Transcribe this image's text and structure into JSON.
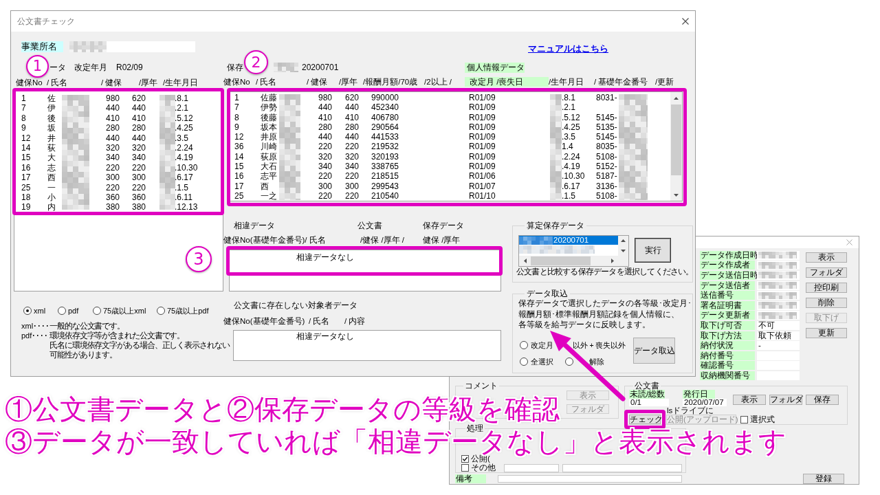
{
  "main_window": {
    "title": "公文書チェック",
    "office_label": "事業所名",
    "manual_link": "マニュアルはこちら",
    "official": {
      "label_end": "ータ",
      "revision_label": "改定年月",
      "revision_value": "R02/09",
      "columns": [
        "健保No",
        "/ 氏名",
        "/ 健保",
        "/厚年",
        "/生年月日"
      ],
      "rows": [
        {
          "no": "1",
          "name": "佐",
          "health": "980",
          "pension": "620",
          "birth": ".8.1"
        },
        {
          "no": "7",
          "name": "伊",
          "health": "440",
          "pension": "440",
          "birth": ".2.1"
        },
        {
          "no": "8",
          "name": "後",
          "health": "410",
          "pension": "410",
          "birth": ".5.12"
        },
        {
          "no": "9",
          "name": "坂",
          "health": "280",
          "pension": "280",
          "birth": ".4.25"
        },
        {
          "no": "12",
          "name": "井",
          "health": "440",
          "pension": "440",
          "birth": ".3.5"
        },
        {
          "no": "14",
          "name": "荻",
          "health": "320",
          "pension": "320",
          "birth": ".2.24"
        },
        {
          "no": "15",
          "name": "大",
          "health": "340",
          "pension": "340",
          "birth": ".4.19"
        },
        {
          "no": "16",
          "name": "志",
          "health": "220",
          "pension": "220",
          "birth": ".10.30"
        },
        {
          "no": "17",
          "name": "西",
          "health": "300",
          "pension": "300",
          "birth": ".6.17"
        },
        {
          "no": "25",
          "name": "一",
          "health": "220",
          "pension": "220",
          "birth": ".1.5"
        },
        {
          "no": "18",
          "name": "小",
          "health": "360",
          "pension": "360",
          "birth": ".6.11"
        },
        {
          "no": "19",
          "name": "内",
          "health": "380",
          "pension": "380",
          "birth": ".12.13"
        }
      ]
    },
    "saved": {
      "label": "保存",
      "date": "20200701",
      "personal_label": "個人情報データ",
      "columns": [
        {
          "label": "健保No",
          "highlight": false
        },
        {
          "label": "/ 氏名",
          "highlight": false
        },
        {
          "label": "/ 健保",
          "highlight": false
        },
        {
          "label": "/厚年",
          "highlight": false
        },
        {
          "label": "/報酬月額/70歳",
          "highlight": false
        },
        {
          "label": "/2以上 /",
          "highlight": false
        },
        {
          "label": "改定月 /喪失日",
          "highlight": true
        },
        {
          "label": "/生年月日",
          "highlight": false
        },
        {
          "label": "/ 基礎年金番号",
          "highlight": false
        },
        {
          "label": "/更新",
          "highlight": false
        }
      ],
      "rows": [
        {
          "no": "1",
          "name": "佐藤",
          "health": "980",
          "pension": "620",
          "salary": "990000",
          "revision": "R01/09",
          "birth": ".8.1",
          "pension_no": "8031-"
        },
        {
          "no": "7",
          "name": "伊勢",
          "health": "440",
          "pension": "440",
          "salary": "452340",
          "revision": "R01/09",
          "birth": ".2.1"
        },
        {
          "no": "8",
          "name": "後藤",
          "health": "410",
          "pension": "410",
          "salary": "406780",
          "revision": "R01/09",
          "birth": ".5.12",
          "pension_no": "5145-"
        },
        {
          "no": "9",
          "name": "坂本",
          "health": "280",
          "pension": "280",
          "salary": "290564",
          "revision": "R01/09",
          "birth": ".4.25",
          "pension_no": "5135-"
        },
        {
          "no": "12",
          "name": "井原",
          "health": "440",
          "pension": "440",
          "salary": "441533",
          "revision": "R01/09",
          "birth": ".3.5",
          "pension_no": "5145-"
        },
        {
          "no": "36",
          "name": "川崎",
          "health": "220",
          "pension": "220",
          "salary": "219532",
          "revision": "R01/09",
          "birth": "1.4",
          "pension_no": "8035-"
        },
        {
          "no": "14",
          "name": "荻原",
          "health": "320",
          "pension": "320",
          "salary": "320193",
          "revision": "R01/09",
          "birth": ".2.24",
          "pension_no": "5108-"
        },
        {
          "no": "15",
          "name": "大石",
          "health": "340",
          "pension": "340",
          "salary": "338765",
          "revision": "R01/09",
          "birth": ".4.19",
          "pension_no": "5152-"
        },
        {
          "no": "16",
          "name": "志平",
          "health": "220",
          "pension": "220",
          "salary": "218515",
          "revision": "R01/06",
          "birth": ".10.30",
          "pension_no": "5187-"
        },
        {
          "no": "17",
          "name": "西",
          "health": "300",
          "pension": "300",
          "salary": "299543",
          "revision": "R01/07",
          "birth": ".6.17",
          "pension_no": "3136-"
        },
        {
          "no": "25",
          "name": "一之",
          "health": "220",
          "pension": "220",
          "salary": "210540",
          "revision": "R01/10",
          "birth": ".1.5",
          "pension_no": "5108-"
        }
      ]
    },
    "diff": {
      "title": "相違データ",
      "official_label": "公文書",
      "saved_label": "保存データ",
      "columns": [
        "健保No(基礎年金番号)/ 氏名",
        "/健保 /厚年 /",
        "健保 /厚年"
      ],
      "message": "相違データなし"
    },
    "missing": {
      "title": "公文書に存在しない対象者データ",
      "columns": [
        "健保No(基礎年金番号)",
        "/ 氏名",
        "/ 内容"
      ],
      "message": "相違データなし"
    },
    "formats": [
      {
        "label": "xml",
        "selected": true
      },
      {
        "label": "pdf",
        "selected": false
      },
      {
        "label": "75歳以上xml",
        "selected": false
      },
      {
        "label": "75歳以上pdf",
        "selected": false
      }
    ],
    "notes": [
      {
        "term": "xml････",
        "lines": [
          "一般的な公文書です。"
        ]
      },
      {
        "term": "pdf････",
        "lines": [
          "環境依存文字等が含まれた公文書です。",
          "氏名に環境依存文字がある場合、正しく表示されない",
          "可能性があります。"
        ]
      }
    ],
    "calc_group": {
      "title": "算定保存データ",
      "items": [
        {
          "text": "20200701",
          "selected": true
        },
        {
          "selected": false
        }
      ],
      "run_button": "実行",
      "hint": "公文書と比較する保存データを選択してください。"
    },
    "import_group": {
      "title": "データ取込",
      "description": [
        "保存データで選択したデータの各等級･改定月･",
        "報酬月額･標準報酬月額記録を個人情報に、",
        "各等級を給与データに反映します。"
      ],
      "options": [
        {
          "label": "改定月",
          "label_after": "以外 + 喪失以外",
          "selected": false
        },
        {
          "label": "全選択",
          "selected": false
        },
        {
          "label": "解除",
          "selected": false
        }
      ],
      "button": "データ取込"
    }
  },
  "sub_window": {
    "fields": [
      {
        "label": "データ作成日時",
        "masked": true
      },
      {
        "label": "データ作成者",
        "masked": true
      },
      {
        "label": "データ送信日時",
        "masked": true
      },
      {
        "label": "データ送信者",
        "masked": true
      },
      {
        "label": "送信番号",
        "masked": true
      },
      {
        "label": "署名証明書",
        "masked": true
      },
      {
        "label": "データ更新者",
        "masked": true
      },
      {
        "label": "取下げ可否",
        "value": "不可",
        "masked": false
      },
      {
        "label": "取下げ方法",
        "value": "取下依頼",
        "masked": false
      },
      {
        "label": "納付状況",
        "value": "-",
        "masked": false
      },
      {
        "label": "納付番号",
        "masked": false
      },
      {
        "label": "確認番号",
        "masked": false
      },
      {
        "label": "収納機関番号",
        "masked": false
      }
    ],
    "side_buttons": [
      {
        "label": "表示",
        "disabled": false
      },
      {
        "label": "フォルダ",
        "disabled": false
      },
      {
        "label": "控印刷",
        "disabled": false
      },
      {
        "label": "削除",
        "disabled": false
      },
      {
        "label": "取下げ",
        "disabled": true
      },
      {
        "label": "更新",
        "disabled": false
      }
    ],
    "comment_group": {
      "title": "コメント",
      "buttons": [
        {
          "label": "表示",
          "disabled": true
        },
        {
          "label": "フォルダ",
          "disabled": true
        }
      ]
    },
    "document_group": {
      "title": "公文書",
      "unread_label": "未読/総数",
      "unread_value": "0/1",
      "issue_label": "発行日",
      "issue_value": "2020/07/07",
      "buttons": [
        {
          "label": "表示",
          "disabled": false
        },
        {
          "label": "フォルダ",
          "disabled": false
        },
        {
          "label": "保存",
          "disabled": false
        }
      ],
      "drive_note": "lsドライブに",
      "check_button": "チェック",
      "publish_button": {
        "label": "公開(アップロード)",
        "disabled": true
      },
      "select_checkbox": {
        "label": "選択式",
        "checked": false
      }
    },
    "process_group": {
      "title": "処理",
      "checkboxes": [
        {
          "label": "公開(",
          "checked": true
        },
        {
          "label": "その他",
          "checked": false
        }
      ]
    },
    "remarks_label": "備考",
    "register_button": "登録"
  },
  "annotations": {
    "markers": [
      "1",
      "2",
      "3"
    ],
    "captions": [
      "①公文書データと②保存データの等級を確認",
      "③データが一致していれば「相違データなし」と表示されます"
    ]
  }
}
